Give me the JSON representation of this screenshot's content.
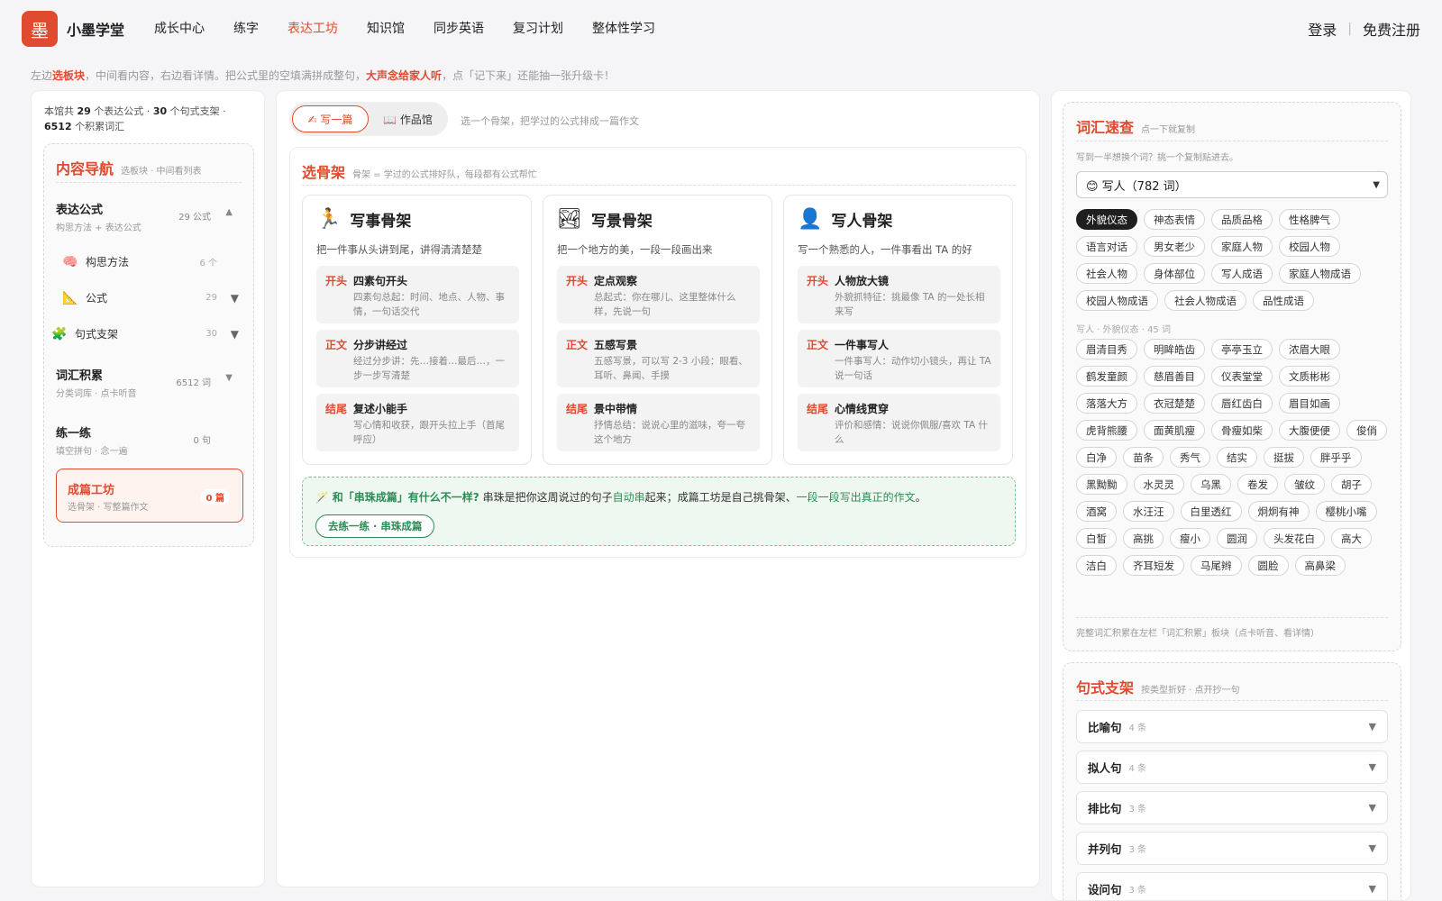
{
  "app": {
    "logo": "墨",
    "name": "小墨学堂"
  },
  "nav": [
    "成长中心",
    "练字",
    "表达工坊",
    "知识馆",
    "同步英语",
    "复习计划",
    "整体性学习"
  ],
  "auth": {
    "login": "登录",
    "sep": "|",
    "register": "免费注册"
  },
  "hint": {
    "p1": "左边",
    "e1": "选板块",
    "p2": "，中间看内容，右边看详情。把公式里的空填满拼成整句，",
    "e2": "大声念给家人听",
    "p3": "，点「记下来」还能抽一张升级卡！"
  },
  "stats": {
    "p1": "本馆共 ",
    "n1": "29",
    "p2": " 个表达公式 · ",
    "n2": "30",
    "p3": " 个句式支架 · ",
    "n3": "6512",
    "p4": " 个积累词汇"
  },
  "leftnav": {
    "title": "内容导航",
    "subtitle": "选板块 · 中间看列表",
    "items": [
      {
        "title": "表达公式",
        "sub": "构思方法 + 表达公式",
        "count": "29 公式",
        "arrow": "▲"
      },
      {
        "title": "词汇积累",
        "sub": "分类词库 · 点卡听音",
        "count": "6512 词",
        "arrow": "▼"
      },
      {
        "title": "练一练",
        "sub": "填空拼句 · 念一遍",
        "count": "0 句",
        "arrow": ""
      }
    ],
    "subitems": [
      {
        "icon": "🧠",
        "label": "构思方法",
        "count": "6 个",
        "arrow": ""
      },
      {
        "icon": "📐",
        "label": "公式",
        "count": "29",
        "arrow": "▼"
      },
      {
        "icon": "🧩",
        "label": "句式支架",
        "count": "30",
        "arrow": "▼"
      }
    ],
    "active": {
      "title": "成篇工坊",
      "sub": "选骨架 · 写整篇作文",
      "badge": "0 篇"
    }
  },
  "mid": {
    "tabs": [
      "✍ 写一篇",
      "📖 作品馆"
    ],
    "tab_hint": "选一个骨架，把学过的公式排成一篇作文",
    "section_title": "选骨架",
    "section_sub": "骨架 = 学过的公式排好队，每段都有公式帮忙",
    "cards": [
      {
        "icon": "🏃",
        "name": "写事骨架",
        "desc": "把一件事从头讲到尾，讲得清清楚楚",
        "segs": [
          {
            "tag": "开头",
            "name": "四素句开头",
            "desc": "四素句总起：时间、地点、人物、事情，一句话交代"
          },
          {
            "tag": "正文",
            "name": "分步讲经过",
            "desc": "经过分步讲：先…接着…最后…，一步一步写清楚"
          },
          {
            "tag": "结尾",
            "name": "复述小能手",
            "desc": "写心情和收获，跟开头拉上手（首尾呼应）"
          }
        ]
      },
      {
        "icon": "🏞",
        "name": "写景骨架",
        "desc": "把一个地方的美，一段一段画出来",
        "segs": [
          {
            "tag": "开头",
            "name": "定点观察",
            "desc": "总起式：你在哪儿、这里整体什么样，先说一句"
          },
          {
            "tag": "正文",
            "name": "五感写景",
            "desc": "五感写景，可以写 2-3 小段：眼看、耳听、鼻闻、手摸"
          },
          {
            "tag": "结尾",
            "name": "景中带情",
            "desc": "抒情总结：说说心里的滋味，夸一夸这个地方"
          }
        ]
      },
      {
        "icon": "👤",
        "name": "写人骨架",
        "desc": "写一个熟悉的人，一件事看出 TA 的好",
        "segs": [
          {
            "tag": "开头",
            "name": "人物放大镜",
            "desc": "外貌抓特征：挑最像 TA 的一处长相来写"
          },
          {
            "tag": "正文",
            "name": "一件事写人",
            "desc": "一件事写人：动作切小镜头，再让 TA 说一句话"
          },
          {
            "tag": "结尾",
            "name": "心情线贯穿",
            "desc": "评价和感情：说说你佩服/喜欢 TA 什么"
          }
        ]
      }
    ],
    "note": {
      "icon": "🪄",
      "q": "和「串珠成篇」有什么不一样?",
      "t1": " 串珠是把你这周说过的句子",
      "g1": "自动串",
      "t2": "起来；成篇工坊是自己挑骨架、",
      "g2": "一段一段写出真正的作文",
      "t3": "。",
      "button": "去练一练 · 串珠成篇"
    }
  },
  "vocab": {
    "title": "词汇速查",
    "subtitle": "点一下就复制",
    "tip": "写到一半想换个词？挑一个复制贴进去。",
    "select": "😊 写人（782 词）",
    "categories": [
      "外貌仪态",
      "神态表情",
      "品质品格",
      "性格脾气",
      "语言对话",
      "男女老少",
      "家庭人物",
      "校园人物",
      "社会人物",
      "身体部位",
      "写人成语",
      "家庭人物成语",
      "校园人物成语",
      "社会人物成语",
      "品性成语"
    ],
    "active_category": "外貌仪态",
    "cat_label": "写人 · 外貌仪态 · 45 词",
    "words": [
      "眉清目秀",
      "明眸皓齿",
      "亭亭玉立",
      "浓眉大眼",
      "鹤发童颜",
      "慈眉善目",
      "仪表堂堂",
      "文质彬彬",
      "落落大方",
      "衣冠楚楚",
      "唇红齿白",
      "眉目如画",
      "虎背熊腰",
      "面黄肌瘦",
      "骨瘦如柴",
      "大腹便便",
      "俊俏",
      "白净",
      "苗条",
      "秀气",
      "结实",
      "挺拔",
      "胖乎乎",
      "黑黝黝",
      "水灵灵",
      "乌黑",
      "卷发",
      "皱纹",
      "胡子",
      "酒窝",
      "水汪汪",
      "白里透红",
      "炯炯有神",
      "樱桃小嘴",
      "白皙",
      "高挑",
      "瘦小",
      "圆润",
      "头发花白",
      "高大",
      "洁白",
      "齐耳短发",
      "马尾辫",
      "圆脸",
      "高鼻梁"
    ],
    "footer": "完整词汇积累在左栏「词汇积累」板块（点卡听音、看详情）"
  },
  "sentence": {
    "title": "句式支架",
    "subtitle": "按类型折好 · 点开抄一句",
    "rows": [
      {
        "name": "比喻句",
        "count": "4 条"
      },
      {
        "name": "拟人句",
        "count": "4 条"
      },
      {
        "name": "排比句",
        "count": "3 条"
      },
      {
        "name": "并列句",
        "count": "3 条"
      },
      {
        "name": "设问句",
        "count": "3 条"
      }
    ]
  },
  "colors": {
    "accent": "#e04a2f",
    "green": "#2e8b57",
    "dark_chip": "#1f1f1f"
  }
}
